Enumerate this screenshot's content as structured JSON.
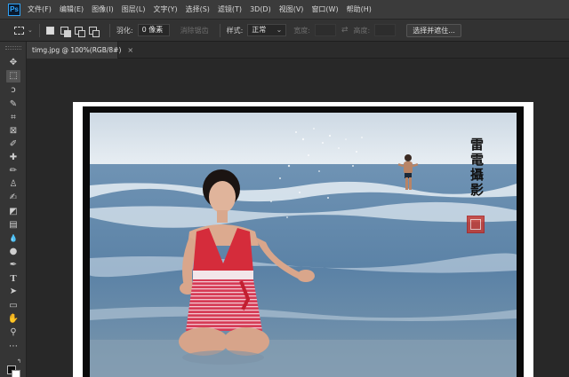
{
  "app": {
    "logo": "Ps",
    "accent_color": "#31a8ff"
  },
  "menu": [
    {
      "label": "文件(F)"
    },
    {
      "label": "编辑(E)"
    },
    {
      "label": "图像(I)"
    },
    {
      "label": "图层(L)"
    },
    {
      "label": "文字(Y)"
    },
    {
      "label": "选择(S)"
    },
    {
      "label": "滤镜(T)"
    },
    {
      "label": "3D(D)"
    },
    {
      "label": "视图(V)"
    },
    {
      "label": "窗口(W)"
    },
    {
      "label": "帮助(H)"
    }
  ],
  "options": {
    "tool_icon": "rect-marquee-icon",
    "feather_label": "羽化:",
    "feather_value": "0 像素",
    "antialias_label": "消除锯齿",
    "style_label": "样式:",
    "style_value": "正常",
    "width_label": "宽度:",
    "height_label": "高度:",
    "select_mask_button": "选择并遮住..."
  },
  "document": {
    "tab_title": "timg.jpg @ 100%(RGB/8#)",
    "close_glyph": "×"
  },
  "tools": [
    {
      "name": "move-tool-icon",
      "glyph": "✥"
    },
    {
      "name": "rect-marquee-tool-icon",
      "glyph": "⬚"
    },
    {
      "name": "lasso-tool-icon",
      "glyph": "ↄ"
    },
    {
      "name": "quick-select-tool-icon",
      "glyph": "✎"
    },
    {
      "name": "crop-tool-icon",
      "glyph": "⌗"
    },
    {
      "name": "frame-tool-icon",
      "glyph": "⊠"
    },
    {
      "name": "eyedropper-tool-icon",
      "glyph": "✐"
    },
    {
      "name": "healing-brush-tool-icon",
      "glyph": "✚"
    },
    {
      "name": "brush-tool-icon",
      "glyph": "✏"
    },
    {
      "name": "clone-stamp-tool-icon",
      "glyph": "♙"
    },
    {
      "name": "history-brush-tool-icon",
      "glyph": "✍"
    },
    {
      "name": "eraser-tool-icon",
      "glyph": "◩"
    },
    {
      "name": "gradient-tool-icon",
      "glyph": "▤"
    },
    {
      "name": "blur-tool-icon",
      "glyph": "💧"
    },
    {
      "name": "dodge-tool-icon",
      "glyph": "●"
    },
    {
      "name": "pen-tool-icon",
      "glyph": "✒"
    },
    {
      "name": "type-tool-icon",
      "glyph": "T"
    },
    {
      "name": "path-select-tool-icon",
      "glyph": "➤"
    },
    {
      "name": "rectangle-shape-tool-icon",
      "glyph": "▭"
    },
    {
      "name": "hand-tool-icon",
      "glyph": "✋"
    },
    {
      "name": "zoom-tool-icon",
      "glyph": "⚲"
    },
    {
      "name": "more-tools-icon",
      "glyph": "⋯"
    }
  ],
  "colors": {
    "foreground": "#0e0e0e",
    "background": "#ffffff"
  },
  "photo": {
    "caption": "雷電攝影"
  }
}
